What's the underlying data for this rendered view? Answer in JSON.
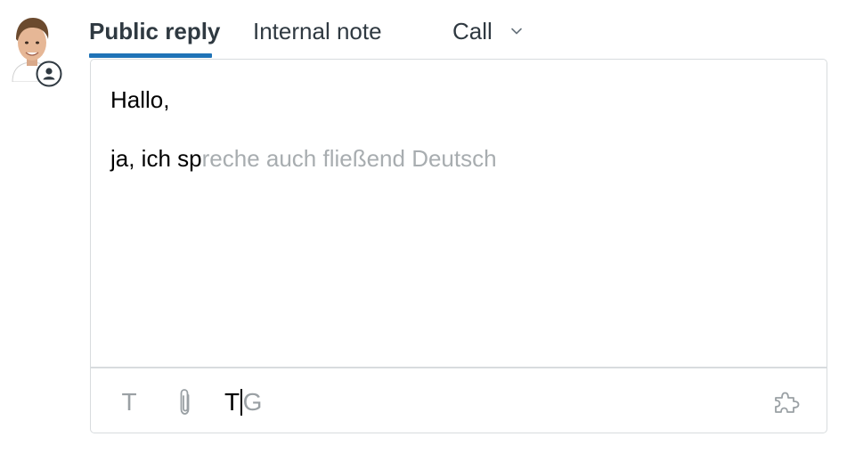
{
  "tabs": {
    "public_reply": "Public reply",
    "internal_note": "Internal note",
    "call": "Call"
  },
  "editor": {
    "line1": "Hallo,",
    "line2_typed": "ja, ich sp",
    "line2_suggestion": "reche auch fließend Deutsch"
  },
  "toolbar": {
    "format_icon": "T",
    "translate_t": "T",
    "translate_g": "G"
  },
  "icons": {
    "avatar": "user-photo",
    "badge": "user-circle-icon",
    "chevron": "chevron-down-icon",
    "attach": "paperclip-icon",
    "apps": "puzzle-piece-icon"
  },
  "colors": {
    "active_tab_underline": "#1f73b7",
    "text_primary": "#2f3941",
    "suggestion_text": "#a8adb0",
    "icon_gray": "#9aa0a4",
    "border": "#d8dcde"
  }
}
